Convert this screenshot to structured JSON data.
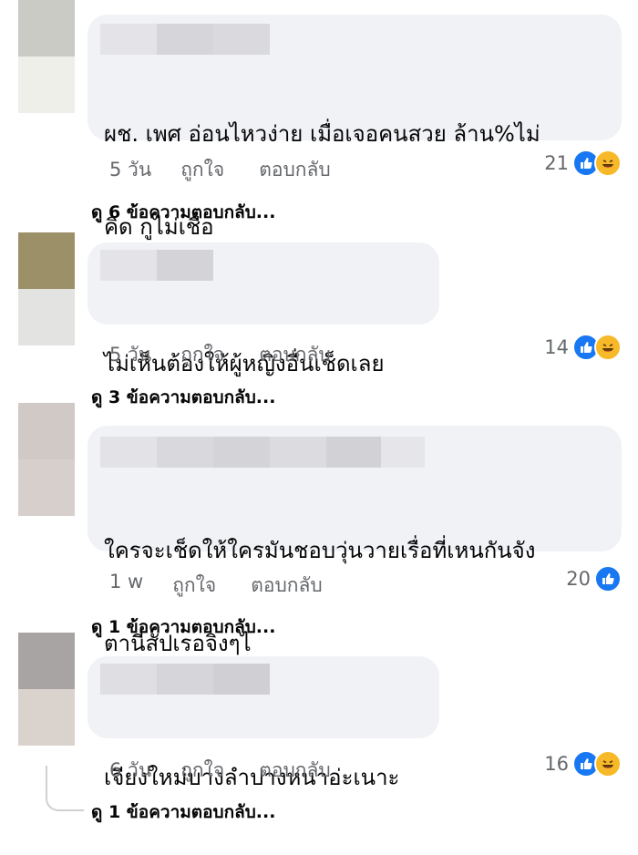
{
  "comments": [
    {
      "text": "ผช. เพศ อ่อนไหวง่าย เมื่อเจอคนสวย ล้าน%ไม่คิด กูไม่เชื่อ",
      "line1": "ผช. เพศ อ่อนไหวง่าย เมื่อเจอคนสวย ล้าน%ไม่",
      "line2": "คิด กูไม่เชื่อ",
      "time": "5 วัน",
      "like_label": "ถูกใจ",
      "reply_label": "ตอบกลับ",
      "reaction_count": "21",
      "reactions": [
        "like-icon",
        "haha-icon"
      ],
      "view_replies": "ดู 6 ข้อความตอบกลับ..."
    },
    {
      "line1": "ไม่เห็นต้องให้ผู้หญิงอื่นเช็ดเลย",
      "time": "5 วัน",
      "like_label": "ถูกใจ",
      "reply_label": "ตอบกลับ",
      "reaction_count": "14",
      "reactions": [
        "like-icon",
        "haha-icon"
      ],
      "view_replies": "ดู 3 ข้อความตอบกลับ..."
    },
    {
      "line1": "ใครจะเช็ดให้ใครมันชอบวุ่นวายเรื่อที่เหนกันจัง",
      "line2": "ตานี่สัปเรอจิงๆไ",
      "time": "1 w",
      "like_label": "ถูกใจ",
      "reply_label": "ตอบกลับ",
      "reaction_count": "20",
      "reactions": [
        "like-icon"
      ],
      "view_replies": "ดู 1 ข้อความตอบกลับ..."
    },
    {
      "line1": "เจียงใหม่บางลำปางหนาอ่ะเนาะ",
      "time": "6 วัน",
      "like_label": "ถูกใจ",
      "reply_label": "ตอบกลับ",
      "reaction_count": "16",
      "reactions": [
        "like-icon",
        "haha-icon"
      ],
      "view_replies": "ดู 1 ข้อความตอบกลับ..."
    }
  ],
  "colors": {
    "bubble": "#f0f2f5",
    "meta": "#65676b",
    "like": "#1877f2",
    "haha": "#f7b928"
  }
}
